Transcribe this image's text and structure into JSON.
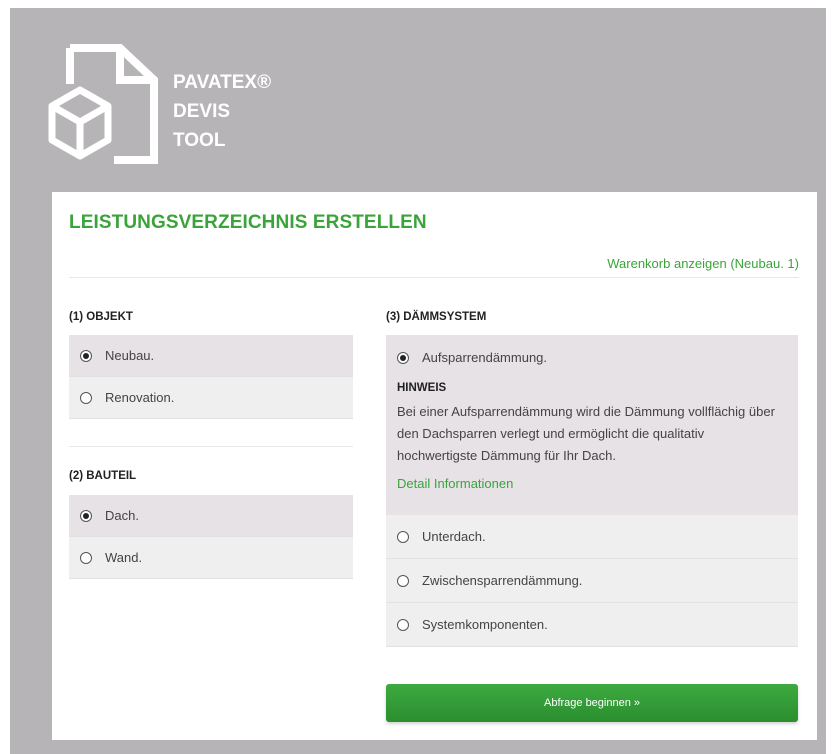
{
  "brand": {
    "lines": [
      "PAVATEX®",
      "DEVIS",
      "TOOL"
    ],
    "logo_icon": "document-box-icon"
  },
  "page": {
    "title": "LEISTUNGSVERZEICHNIS ERSTELLEN",
    "cart_link": "Warenkorb anzeigen (Neubau. 1)"
  },
  "objekt": {
    "label": "(1) OBJEKT",
    "options": [
      {
        "label": "Neubau.",
        "checked": true
      },
      {
        "label": "Renovation.",
        "checked": false
      }
    ]
  },
  "bauteil": {
    "label": "(2) BAUTEIL",
    "options": [
      {
        "label": "Dach.",
        "checked": true
      },
      {
        "label": "Wand.",
        "checked": false
      }
    ]
  },
  "daemmsystem": {
    "label": "(3) DÄMMSYSTEM",
    "selected": {
      "label": "Aufsparrendämmung.",
      "hint_title": "HINWEIS",
      "hint_text": "Bei einer Aufsparrendämmung wird die Dämmung vollflächig über den Dachsparren verlegt und ermöglicht die qualitativ hochwertigste Dämmung für Ihr Dach.",
      "detail_link": "Detail Informationen"
    },
    "options": [
      {
        "label": "Unterdach.",
        "checked": false
      },
      {
        "label": "Zwischensparrendämmung.",
        "checked": false
      },
      {
        "label": "Systemkomponenten.",
        "checked": false
      }
    ]
  },
  "submit_label": "Abfrage beginnen »",
  "colors": {
    "accent": "#3aa43a",
    "frame": "#b6b4b7",
    "selected_row": "#e6e2e6",
    "row": "#efefef"
  }
}
